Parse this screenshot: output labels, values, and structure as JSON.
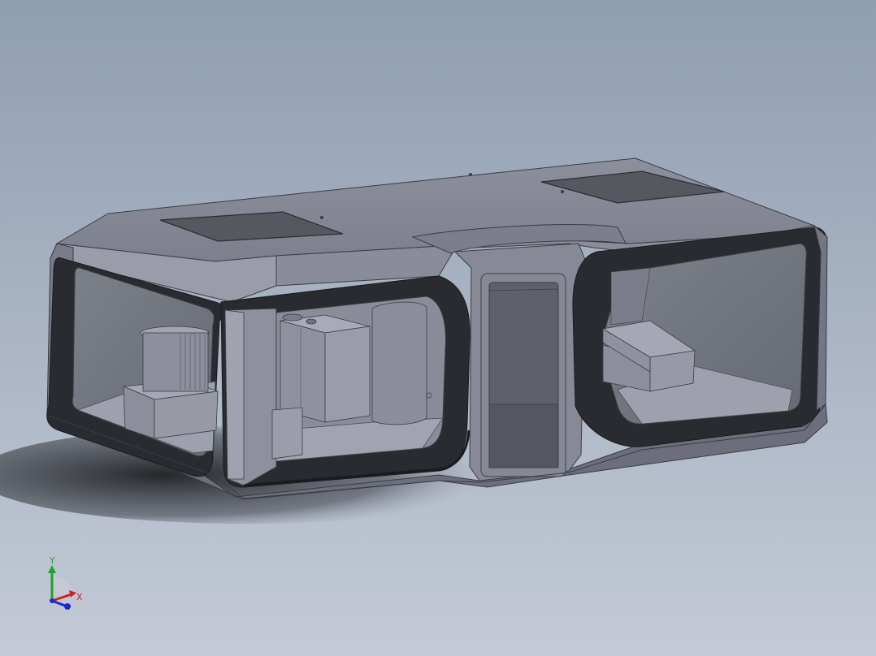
{
  "viewport": {
    "background_top": "#8f9eb1",
    "background_bottom": "#c4cad6"
  },
  "model": {
    "body_color": "#858896",
    "body_light": "#9ea1ad",
    "body_dark": "#6d707d",
    "frame_color": "#2a2b30",
    "glass_color": "#717580",
    "skylight_color": "#55585f"
  },
  "triad": {
    "y_label": "Y",
    "x_label": "X",
    "y_color": "#1fa32c",
    "x_color": "#d42020",
    "z_color": "#1b2bc9"
  }
}
